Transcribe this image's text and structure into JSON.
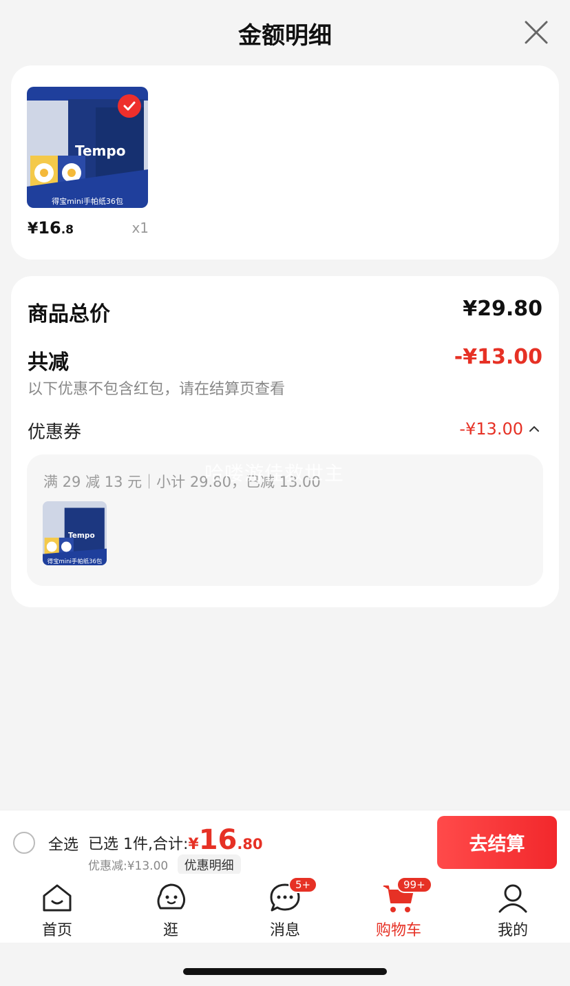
{
  "sheet": {
    "title": "金额明细"
  },
  "product": {
    "thumb_caption": "得宝mini手帕纸36包",
    "price_symbol": "¥",
    "price_int": "16",
    "price_dec": ".8",
    "quantity": "x1"
  },
  "detail": {
    "total_label": "商品总价",
    "total_value": "¥29.80",
    "reduce_label": "共减",
    "reduce_value": "-¥13.00",
    "note": "以下优惠不包含红包，请在结算页查看",
    "coupon_label": "优惠券",
    "coupon_value": "-¥13.00",
    "coupon_rule": "满 29 减 13 元｜小计 29.80，已减 13.00",
    "watermark": "哈喽游佳救世主",
    "mini_caption": "得宝mini手帕纸36包"
  },
  "bottom": {
    "select_all": "全选",
    "summary_prefix": "已选 1件,合计:",
    "total_yen": "¥",
    "total_int": "16",
    "total_dec": ".80",
    "discount_text": "优惠减:¥13.00",
    "detail_pill": "优惠明细",
    "checkout": "去结算"
  },
  "tabs": [
    {
      "label": "首页",
      "icon": "home-icon"
    },
    {
      "label": "逛",
      "icon": "browse-icon"
    },
    {
      "label": "消息",
      "icon": "message-icon",
      "badge": "5+"
    },
    {
      "label": "购物车",
      "icon": "cart-icon",
      "badge": "99+",
      "active": true
    },
    {
      "label": "我的",
      "icon": "profile-icon"
    }
  ],
  "colors": {
    "accent": "#e63125",
    "brand_blue": "#1f3f9c"
  }
}
